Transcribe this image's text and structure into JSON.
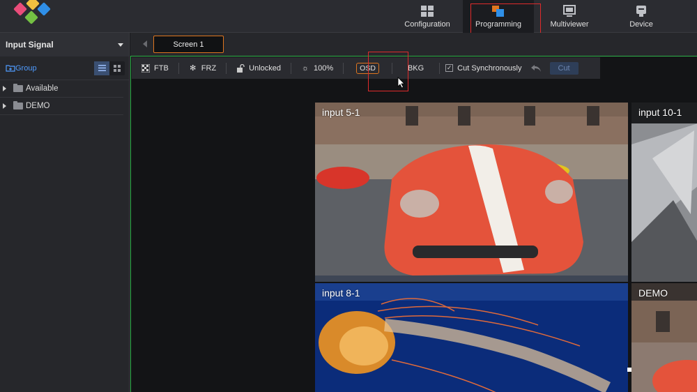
{
  "nav": {
    "tabs": [
      {
        "label": "Configuration",
        "icon": "grid-icon",
        "active": false
      },
      {
        "label": "Programming",
        "icon": "layers-icon",
        "active": true
      },
      {
        "label": "Multiviewer",
        "icon": "monitor-icon",
        "active": false
      },
      {
        "label": "Device",
        "icon": "device-icon",
        "active": false
      }
    ]
  },
  "left_panel": {
    "title": "Input Signal",
    "group_label": "Group",
    "tree": [
      {
        "label": "Available"
      },
      {
        "label": "DEMO"
      }
    ]
  },
  "screen_tab": {
    "label": "Screen 1"
  },
  "toolbar": {
    "ftb": "FTB",
    "frz": "FRZ",
    "lock": "Unlocked",
    "brightness": "100%",
    "osd": "OSD",
    "bkg": "BKG",
    "cut_sync": "Cut Synchronously",
    "cut": "Cut"
  },
  "windows": [
    {
      "label": "input 5-1"
    },
    {
      "label": "input 10-1"
    },
    {
      "label": "input 8-1"
    },
    {
      "label": "DEMO"
    }
  ],
  "colors": {
    "accent_orange": "#e0761f",
    "highlight_red": "#e02b2b",
    "canvas_border_green": "#2fb34a",
    "link_blue": "#4f9cff"
  }
}
